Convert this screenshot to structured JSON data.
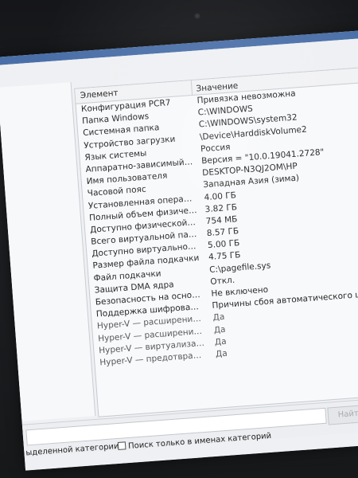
{
  "table": {
    "header": {
      "element": "Элемент",
      "value": "Значение"
    },
    "rows": [
      {
        "element": "Конфигурация PCR7",
        "value": "Привязка невозможна"
      },
      {
        "element": "Папка Windows",
        "value": "C:\\WINDOWS"
      },
      {
        "element": "Системная папка",
        "value": "C:\\WINDOWS\\system32"
      },
      {
        "element": "Устройство загрузки",
        "value": "\\Device\\HarddiskVolume2"
      },
      {
        "element": "Язык системы",
        "value": "Россия"
      },
      {
        "element": "Аппаратно-зависимый уровен...",
        "value": "Версия = \"10.0.19041.2728\""
      },
      {
        "element": "Имя пользователя",
        "value": "DESKTOP-N3QJ2OM\\HP"
      },
      {
        "element": "Часовой пояс",
        "value": "Западная Азия (зима)"
      },
      {
        "element": "Установленная оперативная п...",
        "value": "4.00 ГБ"
      },
      {
        "element": "Полный объем физической па...",
        "value": "3.82 ГБ"
      },
      {
        "element": "Доступно физической памяти",
        "value": "754 МБ"
      },
      {
        "element": "Всего виртуальной памяти",
        "value": "8.57 ГБ"
      },
      {
        "element": "Доступно виртуальной памяти",
        "value": "5.00 ГБ"
      },
      {
        "element": "Размер файла подкачки",
        "value": "4.75 ГБ"
      },
      {
        "element": "Файл подкачки",
        "value": "C:\\pagefile.sys"
      },
      {
        "element": "Защита DMA ядра",
        "value": "Откл."
      },
      {
        "element": "Безопасность на основе вирту...",
        "value": "Не включено"
      },
      {
        "element": "Поддержка шифрования устр...",
        "value": "Причины сбоя автоматического шифрования ус"
      },
      {
        "element": "Hyper-V — расширения режи...",
        "value": "Да"
      },
      {
        "element": "Hyper-V — расширения для п...",
        "value": "Да"
      },
      {
        "element": "Hyper-V — виртуализация вкл...",
        "value": "Да"
      },
      {
        "element": "Hyper-V — предотвращение в...",
        "value": "Да"
      }
    ]
  },
  "search": {
    "selected_category_label": "ыделенной категории",
    "names_only_label": "Поиск только в именах категорий",
    "find_button": "Найти"
  }
}
